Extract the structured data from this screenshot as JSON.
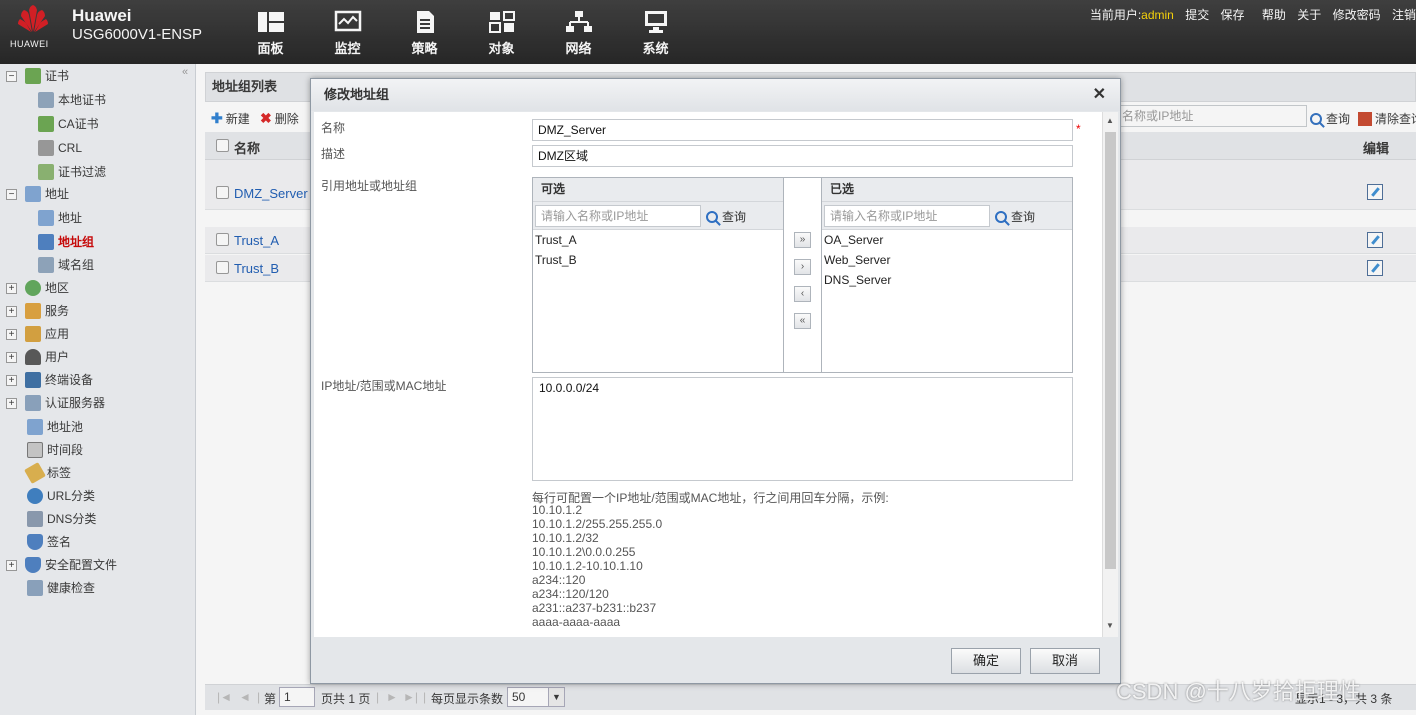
{
  "header": {
    "logo_text": "HUAWEI",
    "brand": "Huawei",
    "model": "USG6000V1-ENSP",
    "nav": [
      {
        "label": "面板",
        "icon": "dashboard-icon"
      },
      {
        "label": "监控",
        "icon": "monitor-icon"
      },
      {
        "label": "策略",
        "icon": "policy-icon"
      },
      {
        "label": "对象",
        "icon": "object-icon"
      },
      {
        "label": "网络",
        "icon": "network-icon"
      },
      {
        "label": "系统",
        "icon": "system-icon"
      }
    ],
    "current_user_label": "当前用户:",
    "current_user": "admin",
    "links": [
      "提交",
      "保存",
      "帮助",
      "关于",
      "修改密码",
      "注销"
    ]
  },
  "sidebar": {
    "collapse": "«",
    "items": [
      {
        "label": "证书",
        "toggle": "−"
      },
      {
        "label": "本地证书"
      },
      {
        "label": "CA证书"
      },
      {
        "label": "CRL"
      },
      {
        "label": "证书过滤"
      },
      {
        "label": "地址",
        "toggle": "−"
      },
      {
        "label": "地址"
      },
      {
        "label": "地址组",
        "active": true
      },
      {
        "label": "域名组"
      },
      {
        "label": "地区",
        "toggle": "+"
      },
      {
        "label": "服务",
        "toggle": "+"
      },
      {
        "label": "应用",
        "toggle": "+"
      },
      {
        "label": "用户",
        "toggle": "+"
      },
      {
        "label": "终端设备",
        "toggle": "+"
      },
      {
        "label": "认证服务器",
        "toggle": "+"
      },
      {
        "label": "地址池"
      },
      {
        "label": "时间段"
      },
      {
        "label": "标签"
      },
      {
        "label": "URL分类"
      },
      {
        "label": "DNS分类"
      },
      {
        "label": "签名"
      },
      {
        "label": "安全配置文件",
        "toggle": "+"
      },
      {
        "label": "健康检查"
      }
    ]
  },
  "main": {
    "title": "地址组列表",
    "toolbar": {
      "new": "新建",
      "delete": "删除",
      "search_placeholder": "名称或IP地址",
      "query": "查询",
      "clear": "清除查询"
    },
    "columns": {
      "name": "名称",
      "edit": "编辑"
    },
    "rows": [
      "DMZ_Server",
      "Trust_A",
      "Trust_B"
    ],
    "footer": {
      "page_prefix": "第",
      "page": "1",
      "page_suffix": "页共 1 页",
      "per_page_label": "每页显示条数",
      "per_page": "50",
      "summary": "显示1 - 3，共 3 条"
    }
  },
  "modal": {
    "title": "修改地址组",
    "name_label": "名称",
    "name_value": "DMZ_Server",
    "desc_label": "描述",
    "desc_value": "DMZ区域",
    "ref_label": "引用地址或地址组",
    "available": {
      "title": "可选",
      "placeholder": "请输入名称或IP地址",
      "query": "查询",
      "items": [
        "Trust_A",
        "Trust_B"
      ]
    },
    "selected": {
      "title": "已选",
      "placeholder": "请输入名称或IP地址",
      "query": "查询",
      "items": [
        "OA_Server",
        "Web_Server",
        "DNS_Server"
      ]
    },
    "move_buttons": [
      "»",
      "›",
      "‹",
      "«"
    ],
    "ip_label": "IP地址/范围或MAC地址",
    "ip_value": "10.0.0.0/24",
    "hint_intro": "每行可配置一个IP地址/范围或MAC地址，行之间用回车分隔，示例:",
    "hint_examples": [
      "10.10.1.2",
      "10.10.1.2/255.255.255.0",
      "10.10.1.2/32",
      "10.10.1.2\\0.0.0.255",
      "10.10.1.2-10.10.1.10",
      "a234::120",
      "a234::120/120",
      "a231::a237-b231::b237",
      "aaaa-aaaa-aaaa"
    ],
    "ok": "确定",
    "cancel": "取消"
  },
  "watermark": "CSDN @十八岁拾拒理性"
}
